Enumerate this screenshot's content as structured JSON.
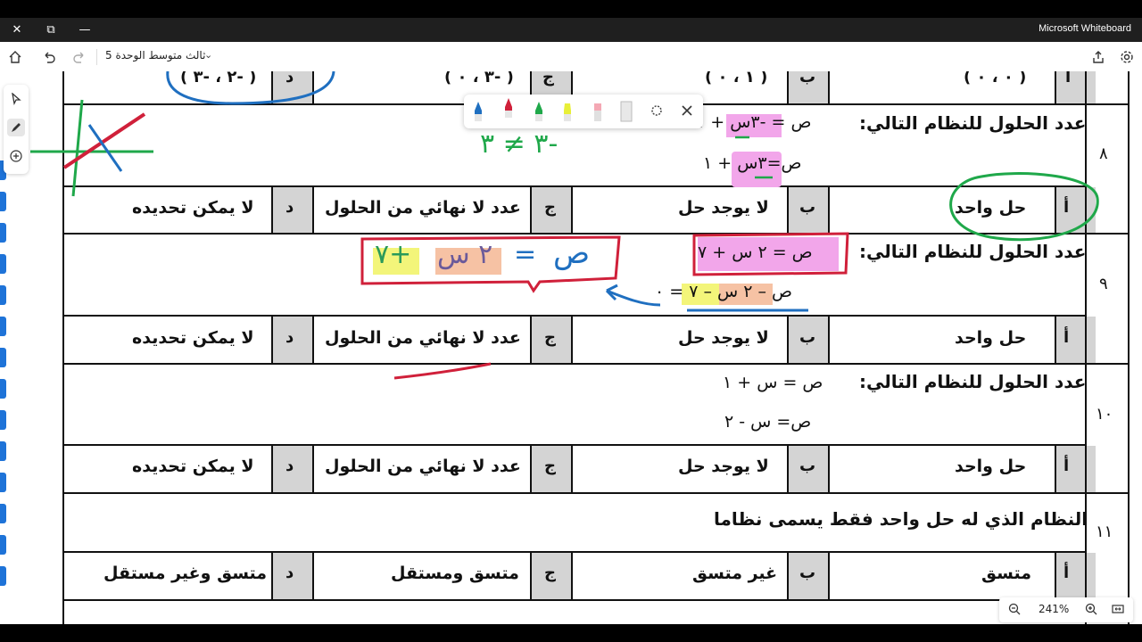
{
  "window": {
    "app_name": "Microsoft Whiteboard",
    "close_glyph": "✕",
    "restore_glyph": "⧉",
    "minimize_glyph": "—"
  },
  "toolbar": {
    "board_title": "ثالث متوسط الوحدة 5",
    "home_icon": "home-icon",
    "undo_icon": "undo-icon",
    "redo_icon": "redo-icon",
    "share_icon": "share-icon",
    "settings_icon": "gear-icon"
  },
  "zoom": {
    "level": "241%"
  },
  "top_row": {
    "a": "( ٠ ، ٠ )",
    "b": "( ١ ، ٠ )",
    "c": "( -٣ ، ٠ )",
    "d": "( -٢ ، -٣ )",
    "letters": [
      "أ",
      "ب",
      "ج",
      "د"
    ]
  },
  "questions": [
    {
      "num": "٨",
      "prompt": "عدد الحلول للنظام التالي:",
      "eq1": "ص = -٣س + ١",
      "eq2": "ص=٣س + ١",
      "options": [
        "حل واحد",
        "لا يوجد حل",
        "عدد لا نهائي من الحلول",
        "لا يمكن تحديده"
      ],
      "letters": [
        "أ",
        "ب",
        "ج",
        "د"
      ]
    },
    {
      "num": "٩",
      "prompt": "عدد الحلول للنظام التالي:",
      "eq1": "ص = ٢ س + ٧",
      "eq2": "ص – ٢ س – ٧ = ٠",
      "options": [
        "حل واحد",
        "لا يوجد حل",
        "عدد لا نهائي من الحلول",
        "لا يمكن تحديده"
      ],
      "letters": [
        "أ",
        "ب",
        "ج",
        "د"
      ]
    },
    {
      "num": "١٠",
      "prompt": "عدد الحلول للنظام التالي:",
      "eq1": "ص = س + ١",
      "eq2": "ص= س - ٢",
      "options": [
        "حل واحد",
        "لا يوجد حل",
        "عدد لا نهائي من الحلول",
        "لا يمكن تحديده"
      ],
      "letters": [
        "أ",
        "ب",
        "ج",
        "د"
      ]
    },
    {
      "num": "١١",
      "prompt": "النظام الذي له حل واحد فقط يسمى نظاما",
      "options": [
        "متسق",
        "غير متسق",
        "متسق ومستقل",
        "متسق وغير مستقل"
      ],
      "letters": [
        "أ",
        "ب",
        "ج",
        "د"
      ]
    }
  ],
  "annotations": {
    "q8_slopes": "-٣ ≠ ٣",
    "q9_rewrite_left": "ص",
    "q9_rewrite_eq": "=",
    "q9_rewrite_mid": "٢ س",
    "q9_rewrite_right": "+٧"
  },
  "colors": {
    "pen_blue": "#1f6fc0",
    "pen_red": "#d0203a",
    "pen_green": "#1fa84a",
    "highlight_pink": "#f2a6ea",
    "highlight_yellow": "#f3f57a",
    "highlight_orange": "#f6c2a4",
    "cell_gray": "#d4d4d4"
  }
}
